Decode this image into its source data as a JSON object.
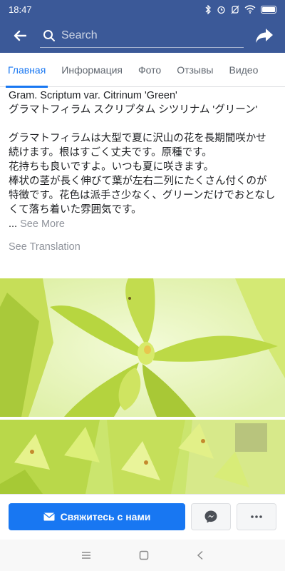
{
  "status_bar": {
    "time": "18:47",
    "icons": [
      "bluetooth-icon",
      "alarm-icon",
      "silent-icon",
      "wifi-icon",
      "battery-icon"
    ]
  },
  "header": {
    "search_placeholder": "Search"
  },
  "tabs": [
    {
      "label": "Главная",
      "active": true
    },
    {
      "label": "Информация",
      "active": false
    },
    {
      "label": "Фото",
      "active": false
    },
    {
      "label": "Отзывы",
      "active": false
    },
    {
      "label": "Видео",
      "active": false
    }
  ],
  "post": {
    "title_latin": "Gram. Scriptum var. Citrinum 'Green'",
    "title_japanese": "グラマトフィラム スクリプタム シツリナム 'グリーン'",
    "body_lines": [
      "グラマトフィラムは大型で夏に沢山の花を長期間咲かせ続けます。根はすごく丈夫です。原種です。",
      "花持ちも良いですよ。いつも夏に咲きます。",
      "棒状の茎が長く伸びて葉が左右二列にたくさん付くのが特徴です。花色は派手さ少なく、グリーンだけでおとなしくて落ち着いた雰囲気です。"
    ],
    "ellipsis": "...",
    "see_more": "See More",
    "see_translation": "See Translation"
  },
  "actions": {
    "contact_label": "Свяжитесь с нами"
  },
  "colors": {
    "brand": "#3b5998",
    "accent": "#1877f2",
    "muted": "#90949c"
  }
}
